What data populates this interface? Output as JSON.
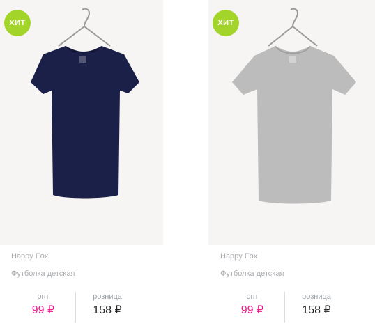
{
  "products": [
    {
      "badge": "ХИТ",
      "brand": "Happy Fox",
      "title": "Футболка детская",
      "opt_label": "опт",
      "opt_price": "99 ₽",
      "retail_label": "розница",
      "retail_price": "158 ₽",
      "shirt_color": "#1b2048"
    },
    {
      "badge": "ХИТ",
      "brand": "Happy Fox",
      "title": "Футболка детская",
      "opt_label": "опт",
      "opt_price": "99 ₽",
      "retail_label": "розница",
      "retail_price": "158 ₽",
      "shirt_color": "#bcbcbc"
    }
  ],
  "colors": {
    "badge": "#a3d42a",
    "opt_price": "#e91e8c",
    "meta_text": "#a9acb0"
  }
}
